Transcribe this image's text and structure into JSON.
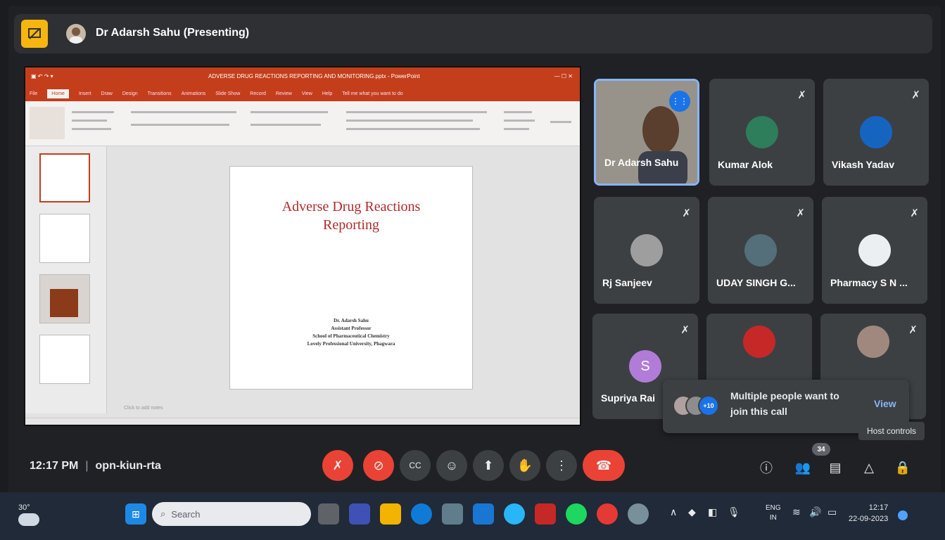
{
  "header": {
    "presenter_label": "Dr Adarsh Sahu (Presenting)",
    "icon": "present-to-all-icon"
  },
  "presentation": {
    "app_title": "ADVERSE DRUG REACTIONS REPORTING AND MONITORING.pptx - PowerPoint",
    "ribbon_tabs": [
      "File",
      "Home",
      "Insert",
      "Draw",
      "Design",
      "Transitions",
      "Animations",
      "Slide Show",
      "Record",
      "Review",
      "View",
      "Help"
    ],
    "active_tab": "Home",
    "tell_me": "Tell me what you want to do",
    "slide_title_line1": "Adverse Drug Reactions",
    "slide_title_line2": "Reporting",
    "author_name": "Dr. Adarsh Sahu",
    "author_role": "Assistant Professor",
    "author_school": "School of Pharmaceutical Chemistry",
    "author_university": "Lovely Professional University, Phagwara",
    "notes_placeholder": "Click to add notes",
    "accent_color": "#c43e1c"
  },
  "participants": [
    {
      "name": "Dr Adarsh Sahu",
      "speaking": true,
      "muted": false
    },
    {
      "name": "Kumar Alok",
      "speaking": false,
      "muted": true
    },
    {
      "name": "Vikash Yadav",
      "speaking": false,
      "muted": true
    },
    {
      "name": "Rj Sanjeev",
      "speaking": false,
      "muted": true
    },
    {
      "name": "UDAY SINGH G...",
      "speaking": false,
      "muted": true
    },
    {
      "name": "Pharmacy S N ...",
      "speaking": false,
      "muted": true
    },
    {
      "name": "Supriya Rai",
      "speaking": false,
      "muted": true,
      "initial": "S"
    },
    {
      "name": "",
      "speaking": false,
      "muted": false
    },
    {
      "name": "",
      "speaking": false,
      "muted": true
    }
  ],
  "join_toast": {
    "badge": "+10",
    "message": "Multiple people want to join this call",
    "view_label": "View"
  },
  "tooltip": "Host controls",
  "meeting": {
    "time": "12:17 PM",
    "code": "opn-kiun-rta",
    "participant_count": "34"
  },
  "controls": [
    {
      "name": "mic-off-icon",
      "glyph": "✗"
    },
    {
      "name": "camera-off-icon",
      "glyph": "⊘"
    },
    {
      "name": "captions-icon",
      "glyph": "CC"
    },
    {
      "name": "emoji-icon",
      "glyph": "☺"
    },
    {
      "name": "present-icon",
      "glyph": "⬆"
    },
    {
      "name": "raise-hand-icon",
      "glyph": "✋"
    },
    {
      "name": "more-options-icon",
      "glyph": "⋮"
    },
    {
      "name": "hang-up-icon",
      "glyph": "☎"
    }
  ],
  "taskbar": {
    "temperature": "30°",
    "search_placeholder": "Search",
    "lang_line1": "ENG",
    "lang_line2": "IN",
    "clock_time": "12:17",
    "clock_date": "22-09-2023"
  }
}
